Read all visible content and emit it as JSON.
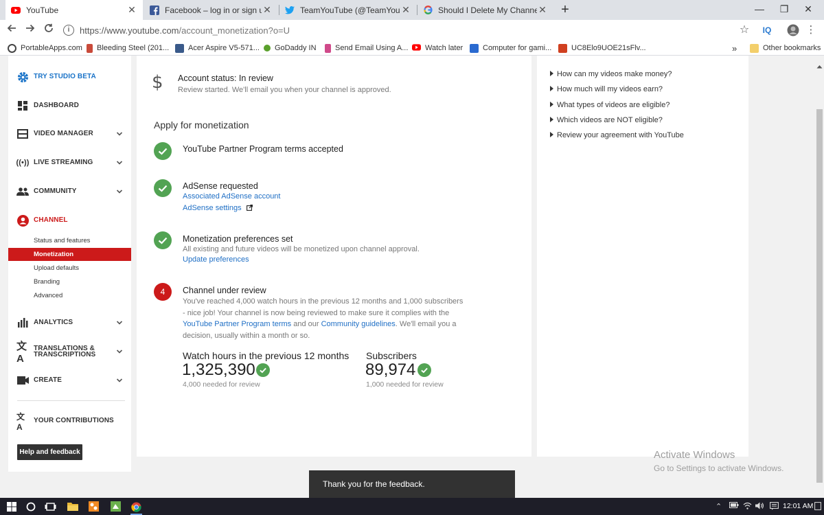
{
  "browser": {
    "tabs": [
      {
        "title": "YouTube",
        "icon": "youtube-icon",
        "active": true
      },
      {
        "title": "Facebook – log in or sign up",
        "icon": "facebook-icon",
        "active": false
      },
      {
        "title": "TeamYouTube (@TeamYouTube) |",
        "icon": "twitter-icon",
        "active": false
      },
      {
        "title": "Should I Delete My Channel. Sho",
        "icon": "google-icon",
        "active": false
      }
    ],
    "new_tab": "+",
    "window_controls": {
      "minimize": "—",
      "maximize": "❐",
      "close": "✕"
    },
    "url_main": "https://www.youtube.com",
    "url_path": "/account_monetization?o=U",
    "toolbar_ext": "IQ",
    "bookmarks": [
      {
        "label": "PortableApps.com",
        "color": "#444444"
      },
      {
        "label": "Bleeding Steel (201...",
        "color": "#c94a3a"
      },
      {
        "label": "Acer Aspire V5-571...",
        "color": "#3a5a8a"
      },
      {
        "label": "GoDaddy IN",
        "color": "#5aa02c"
      },
      {
        "label": "Send Email Using A...",
        "color": "#d04a8a"
      },
      {
        "label": "Watch later",
        "color": "#ff0000"
      },
      {
        "label": "Computer for gami...",
        "color": "#2a6ad0"
      },
      {
        "label": "UC8Elo9UOE21sFlv...",
        "color": "#d04020"
      }
    ],
    "bookmarks_more": "»",
    "other_bookmarks": "Other bookmarks"
  },
  "sidebar": {
    "studio_beta": "TRY STUDIO BETA",
    "dashboard": "DASHBOARD",
    "video_manager": "VIDEO MANAGER",
    "live_streaming": "LIVE STREAMING",
    "community": "COMMUNITY",
    "channel": "CHANNEL",
    "channel_sub": [
      "Status and features",
      "Monetization",
      "Upload defaults",
      "Branding",
      "Advanced"
    ],
    "analytics": "ANALYTICS",
    "translations_1": "TRANSLATIONS &",
    "translations_2": "TRANSCRIPTIONS",
    "create": "CREATE",
    "contributions": "YOUR CONTRIBUTIONS",
    "help": "Help and feedback"
  },
  "main": {
    "account_status": "Account status: In review",
    "account_sub": "Review started. We'll email you when your channel is approved.",
    "apply_title": "Apply for monetization",
    "steps": {
      "s1_title": "YouTube Partner Program terms accepted",
      "s2_title": "AdSense requested",
      "s2_link1": "Associated AdSense account",
      "s2_link2": "AdSense settings",
      "s3_title": "Monetization preferences set",
      "s3_text": "All existing and future videos will be monetized upon channel approval.",
      "s3_link": "Update preferences",
      "s4_num": "4",
      "s4_title": "Channel under review",
      "s4_desc_a": "You've reached 4,000 watch hours in the previous 12 months and 1,000 subscribers - nice job! Your channel is now being reviewed to make sure it complies with the ",
      "s4_link_a": "YouTube Partner Program terms",
      "s4_desc_b": " and our ",
      "s4_link_b": "Community guidelines",
      "s4_desc_c": ". We'll email you a decision, usually within a month or so."
    },
    "stats": {
      "watch_label": "Watch hours in the previous 12 months",
      "watch_value": "1,325,390",
      "watch_note": "4,000 needed for review",
      "subs_label": "Subscribers",
      "subs_value": "89,974",
      "subs_note": "1,000 needed for review"
    }
  },
  "faq": [
    "How can my videos make money?",
    "How much will my videos earn?",
    "What types of videos are eligible?",
    "Which videos are NOT eligible?",
    "Review your agreement with YouTube"
  ],
  "toast": "Thank you for the feedback.",
  "watermark": {
    "line1": "Activate Windows",
    "line2": "Go to Settings to activate Windows."
  },
  "taskbar": {
    "time": "12:01 AM"
  },
  "colors": {
    "accent_red": "#cc1a1a",
    "link_blue": "#1f6fc5",
    "success_green": "#52a353"
  }
}
